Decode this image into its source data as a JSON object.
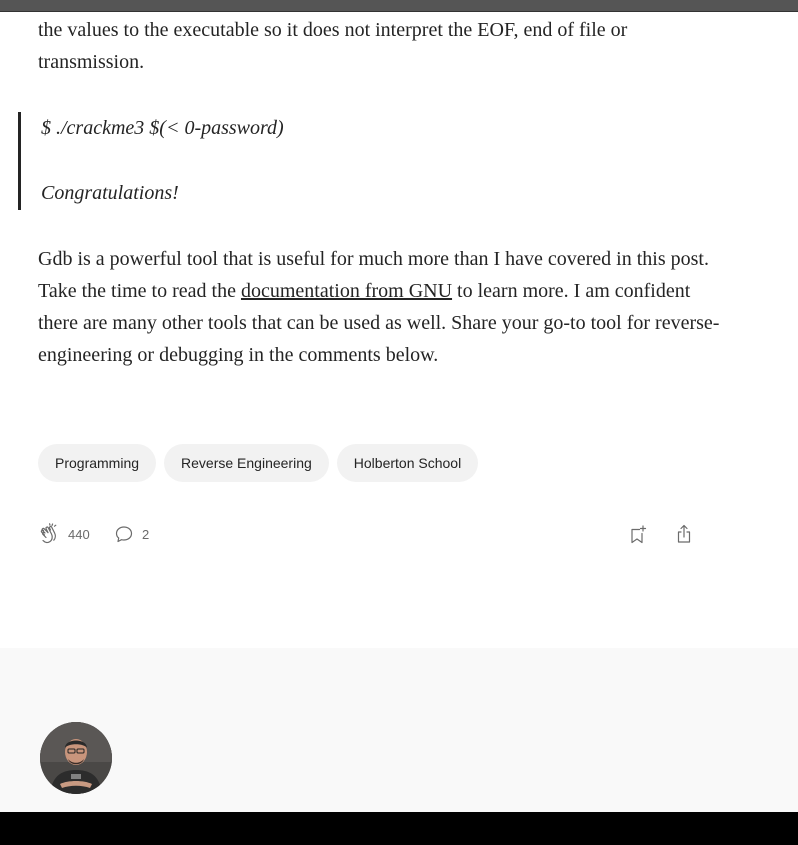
{
  "article": {
    "p1": "the values to the executable so it does not interpret the EOF, end of file or transmission.",
    "quote_line1": "$ ./crackme3 $(< 0-password)",
    "quote_line2": "Congratulations!",
    "p2_before": "Gdb is a powerful tool that is useful for much more than I have covered in this post. Take the time to read the ",
    "p2_link": "documentation from GNU",
    "p2_after": " to learn more. I am confident there are many other tools that can be used as well. Share your go-to tool for reverse-engineering or debugging in the comments below."
  },
  "tags": [
    {
      "label": "Programming"
    },
    {
      "label": "Reverse Engineering"
    },
    {
      "label": "Holberton School"
    }
  ],
  "actions": {
    "claps": "440",
    "responses": "2",
    "icons": [
      "clap-icon",
      "response-icon",
      "bookmark-add-icon",
      "share-icon"
    ]
  },
  "author": {
    "avatar": "author-avatar"
  },
  "colors": {
    "text": "#242424",
    "muted": "#6b6b6b",
    "tag_bg": "#f2f2f2",
    "footer_bg": "#f9f9f9"
  }
}
